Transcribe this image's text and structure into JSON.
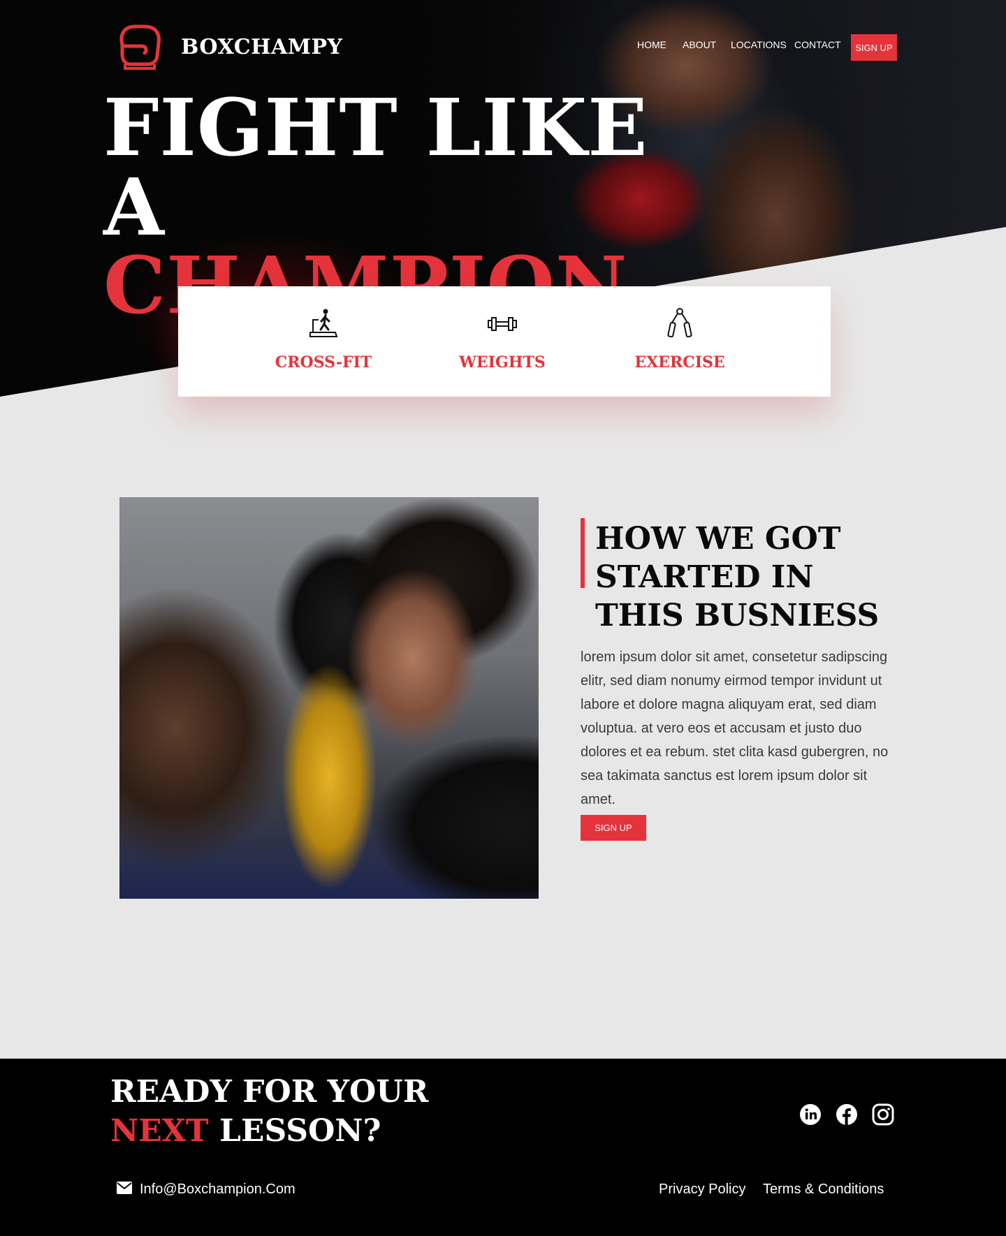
{
  "brand": {
    "name": "BOXCHAMPY",
    "accent": "#e5333b",
    "logo_icon": "boxing-glove-icon"
  },
  "nav": {
    "links": [
      "HOME",
      "ABOUT",
      "LOCATIONS",
      "CONTACT"
    ],
    "signup_label": "SIGN UP"
  },
  "hero": {
    "line1": "FIGHT LIKE",
    "line2_white": "A",
    "line2_red": "CHAMPION"
  },
  "features": [
    {
      "label": "CROSS-FIT",
      "icon": "treadmill-runner-icon"
    },
    {
      "label": "WEIGHTS",
      "icon": "dumbbell-icon"
    },
    {
      "label": "EXERCISE",
      "icon": "hand-grip-icon"
    }
  ],
  "about": {
    "title": "HOW WE GOT STARTED IN THIS BUSNIESS",
    "body": "lorem ipsum dolor sit amet, consetetur sadipscing elitr, sed diam nonumy eirmod tempor invidunt ut labore et dolore magna aliquyam erat, sed diam voluptua. at vero eos et accusam et justo duo dolores et ea rebum. stet clita kasd gubergren, no sea takimata sanctus est lorem ipsum dolor sit amet.",
    "signup_label": "SIGN UP"
  },
  "footer": {
    "cta_line1": "READY FOR YOUR",
    "cta_red": "NEXT",
    "cta_white": "LESSON?",
    "social": [
      "linkedin-icon",
      "facebook-icon",
      "instagram-icon"
    ],
    "email": "Info@Boxchampion.Com",
    "links": [
      "Privacy Policy",
      "Terms & Conditions"
    ]
  }
}
